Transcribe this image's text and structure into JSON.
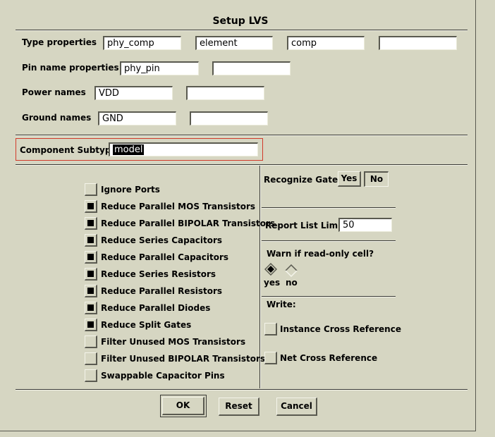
{
  "window": {
    "title": "Setup LVS"
  },
  "type_properties": {
    "label": "Type properties",
    "values": [
      "phy_comp",
      "element",
      "comp",
      ""
    ]
  },
  "pin_name_properties": {
    "label": "Pin name properties",
    "values": [
      "phy_pin",
      ""
    ]
  },
  "power_names": {
    "label": "Power names",
    "values": [
      "VDD",
      ""
    ]
  },
  "ground_names": {
    "label": "Ground names",
    "values": [
      "GND",
      ""
    ]
  },
  "component_subtype": {
    "label": "Component Subtype",
    "value": "model"
  },
  "options": [
    {
      "label": "Ignore Ports",
      "checked": false
    },
    {
      "label": "Reduce Parallel MOS Transistors",
      "checked": true
    },
    {
      "label": "Reduce Parallel BIPOLAR Transistors",
      "checked": true
    },
    {
      "label": "Reduce Series Capacitors",
      "checked": true
    },
    {
      "label": "Reduce Parallel Capacitors",
      "checked": true
    },
    {
      "label": "Reduce Series Resistors",
      "checked": true
    },
    {
      "label": "Reduce Parallel Resistors",
      "checked": true
    },
    {
      "label": "Reduce Parallel Diodes",
      "checked": true
    },
    {
      "label": "Reduce Split Gates",
      "checked": true
    },
    {
      "label": "Filter Unused MOS Transistors",
      "checked": false
    },
    {
      "label": "Filter Unused BIPOLAR Transistors",
      "checked": false
    },
    {
      "label": "Swappable Capacitor Pins",
      "checked": false
    }
  ],
  "recognize_gates": {
    "label": "Recognize Gates",
    "yes_label": "Yes",
    "no_label": "No",
    "selected": "No"
  },
  "report_list_limit": {
    "label": "Report List Limit",
    "value": "50"
  },
  "warn_readonly": {
    "label": "Warn if read-only cell?",
    "yes_label": "yes",
    "no_label": "no",
    "selected": "yes"
  },
  "write": {
    "label": "Write:",
    "items": [
      {
        "label": "Instance Cross Reference",
        "checked": false
      },
      {
        "label": "Net Cross Reference",
        "checked": false
      }
    ]
  },
  "buttons": {
    "ok": "OK",
    "reset": "Reset",
    "cancel": "Cancel"
  }
}
